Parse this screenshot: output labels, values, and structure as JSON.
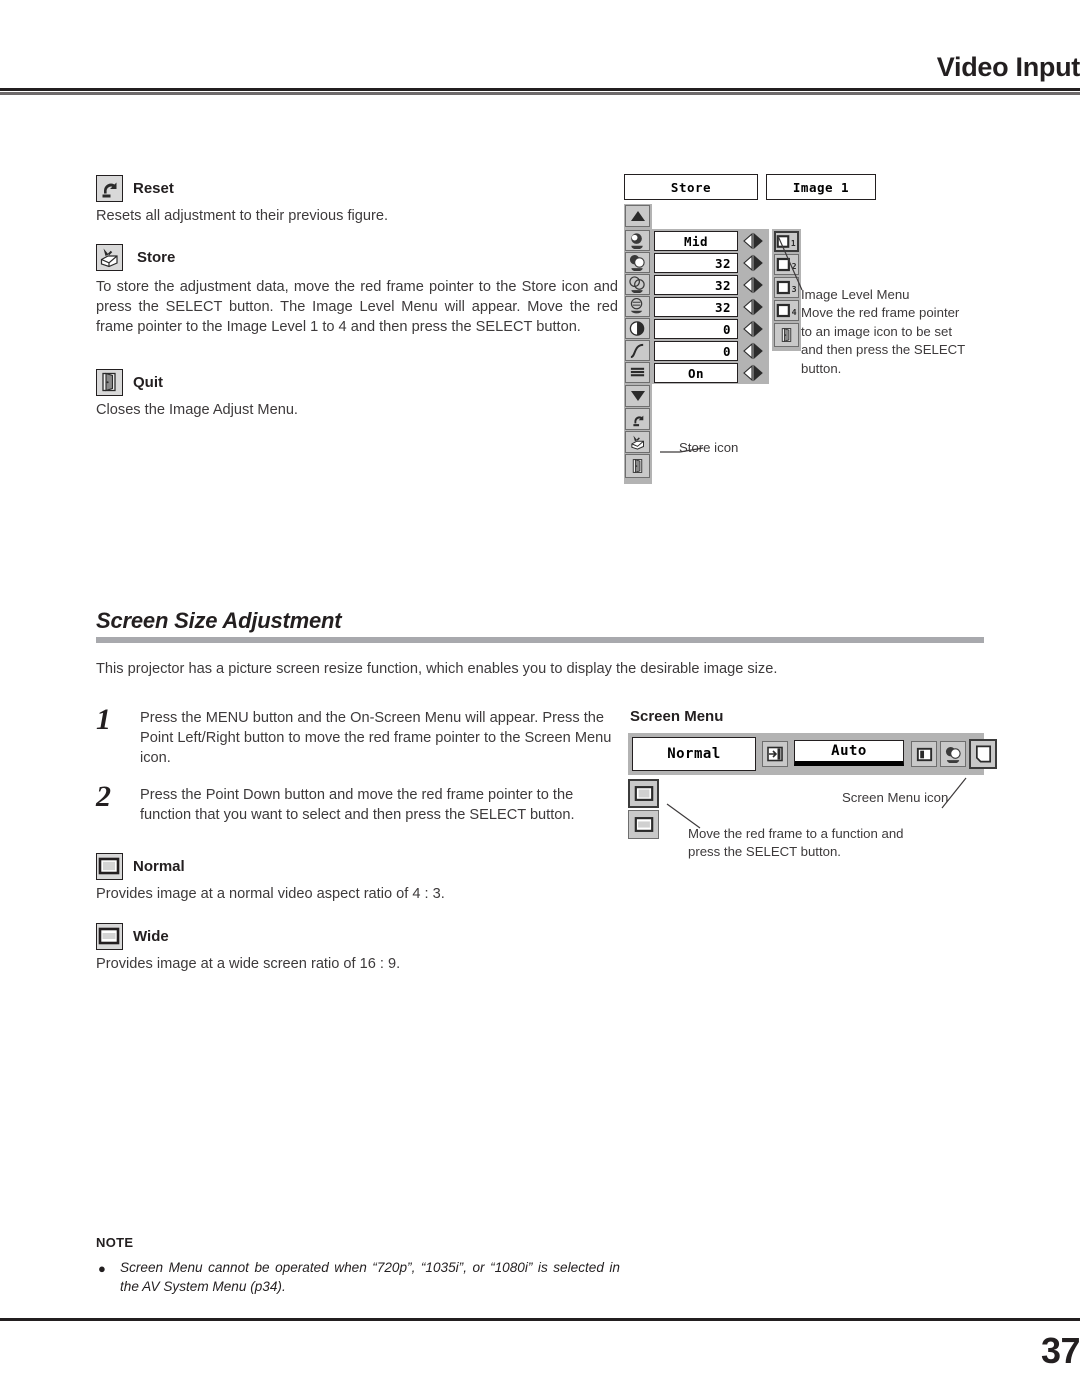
{
  "header": {
    "title": "Video Input"
  },
  "items": [
    {
      "icon": "reset-icon",
      "label": "Reset",
      "text": "Resets all adjustment to their previous figure."
    },
    {
      "icon": "store-icon",
      "label": "Store",
      "text": "To store the adjustment data, move the red frame pointer to the Store icon and press the SELECT button.  The Image Level Menu will appear.  Move the red frame pointer to the Image Level 1 to 4 and then press the SELECT button."
    },
    {
      "icon": "quit-door-icon",
      "label": "Quit",
      "text": "Closes the Image Adjust Menu."
    }
  ],
  "image_adjust_osd": {
    "store_button": "Store",
    "image_level_button": "Image 1",
    "rows": [
      {
        "icon": "contrast-icon",
        "value": "Mid"
      },
      {
        "icon": "color-icon",
        "value": "32"
      },
      {
        "icon": "tint-icon",
        "value": "32"
      },
      {
        "icon": "color-temp-icon",
        "value": "32"
      },
      {
        "icon": "sharpness-icon",
        "value": "0"
      },
      {
        "icon": "gamma-curve-icon",
        "value": "0"
      },
      {
        "icon": "progressive-icon",
        "value": "On"
      }
    ],
    "image_levels": [
      "1",
      "2",
      "3",
      "4"
    ],
    "annotations": {
      "image_level_menu": "Image Level Menu\nMove the red frame pointer\nto an image icon to be set\nand then press the SELECT\nbutton.",
      "store_icon": "Store icon"
    }
  },
  "section": {
    "title": "Screen Size Adjustment",
    "intro": "This projector has a picture screen resize function, which enables you to display the desirable image size."
  },
  "steps": [
    {
      "number": "1",
      "text": "Press the MENU button and the On-Screen Menu will appear. Press the Point Left/Right button to move the red frame pointer to the Screen Menu icon."
    },
    {
      "number": "2",
      "text": "Press the Point Down button and move the red frame pointer to the function that you want to select and then press the SELECT button."
    }
  ],
  "screen_osd": {
    "caption": "Screen Menu",
    "current_value": "Normal",
    "auto_value": "Auto",
    "icons": [
      "input-icon",
      "pc-adjust-icon",
      "image-icon",
      "screen-menu-icon"
    ],
    "function_icons": [
      "normal-screen-icon",
      "wide-screen-icon"
    ],
    "annotations": {
      "screen_menu_icon": "Screen Menu icon",
      "move_frame": "Move the red frame to a function and\npress the SELECT button."
    }
  },
  "modes": [
    {
      "icon": "normal-screen-icon",
      "label": "Normal",
      "text": "Provides image at a normal video aspect ratio of 4 : 3."
    },
    {
      "icon": "wide-screen-icon",
      "label": "Wide",
      "text": "Provides image at a wide screen ratio of 16 : 9."
    }
  ],
  "note": {
    "label": "NOTE",
    "bullet": "●",
    "text": "Screen Menu cannot be operated when “720p”, “1035i”, or “1080i” is selected in the AV System Menu (p34)."
  },
  "footer": {
    "page_number": "37"
  }
}
